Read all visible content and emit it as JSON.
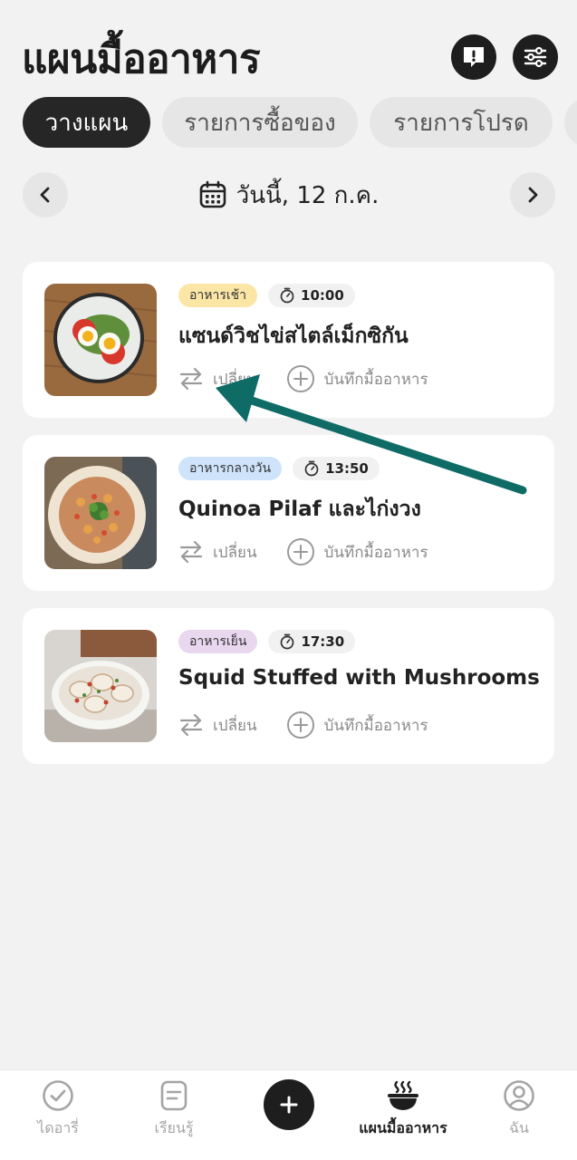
{
  "header": {
    "title": "แผนมื้ออาหาร",
    "alert_icon": "exclamation-bubble-icon",
    "filter_icon": "sliders-icon"
  },
  "tabs": [
    {
      "label": "วางแผน",
      "active": true
    },
    {
      "label": "รายการซื้อของ",
      "active": false
    },
    {
      "label": "รายการโปรด",
      "active": false
    }
  ],
  "date": {
    "label": "วันนี้, 12 ก.ค.",
    "prev_icon": "chevron-left-icon",
    "next_icon": "chevron-right-icon",
    "calendar_icon": "calendar-icon"
  },
  "meals": [
    {
      "type": "อาหารเช้า",
      "type_color": "#fbe6a6",
      "time": "10:00",
      "name": "แซนด์วิชไข่สไตล์เม็กซิกัน",
      "swap_label": "เปลี่ยน",
      "log_label": "บันทึกมื้ออาหาร"
    },
    {
      "type": "อาหารกลางวัน",
      "type_color": "#cfe4fb",
      "time": "13:50",
      "name": "Quinoa Pilaf และไก่งวง",
      "swap_label": "เปลี่ยน",
      "log_label": "บันทึกมื้ออาหาร"
    },
    {
      "type": "อาหารเย็น",
      "type_color": "#e9d6ef",
      "time": "17:30",
      "name": "Squid Stuffed with Mushrooms",
      "swap_label": "เปลี่ยน",
      "log_label": "บันทึกมื้ออาหาร"
    }
  ],
  "annotation": {
    "arrow_color": "#0e6b66"
  },
  "bottom_nav": [
    {
      "label": "ไดอารี่",
      "icon": "check-circle-icon",
      "active": false
    },
    {
      "label": "เรียนรู้",
      "icon": "notes-icon",
      "active": false
    },
    {
      "label": "",
      "icon": "plus-icon",
      "active": false
    },
    {
      "label": "แผนมื้ออาหาร",
      "icon": "bowl-icon",
      "active": true
    },
    {
      "label": "ฉัน",
      "icon": "profile-icon",
      "active": false
    }
  ]
}
